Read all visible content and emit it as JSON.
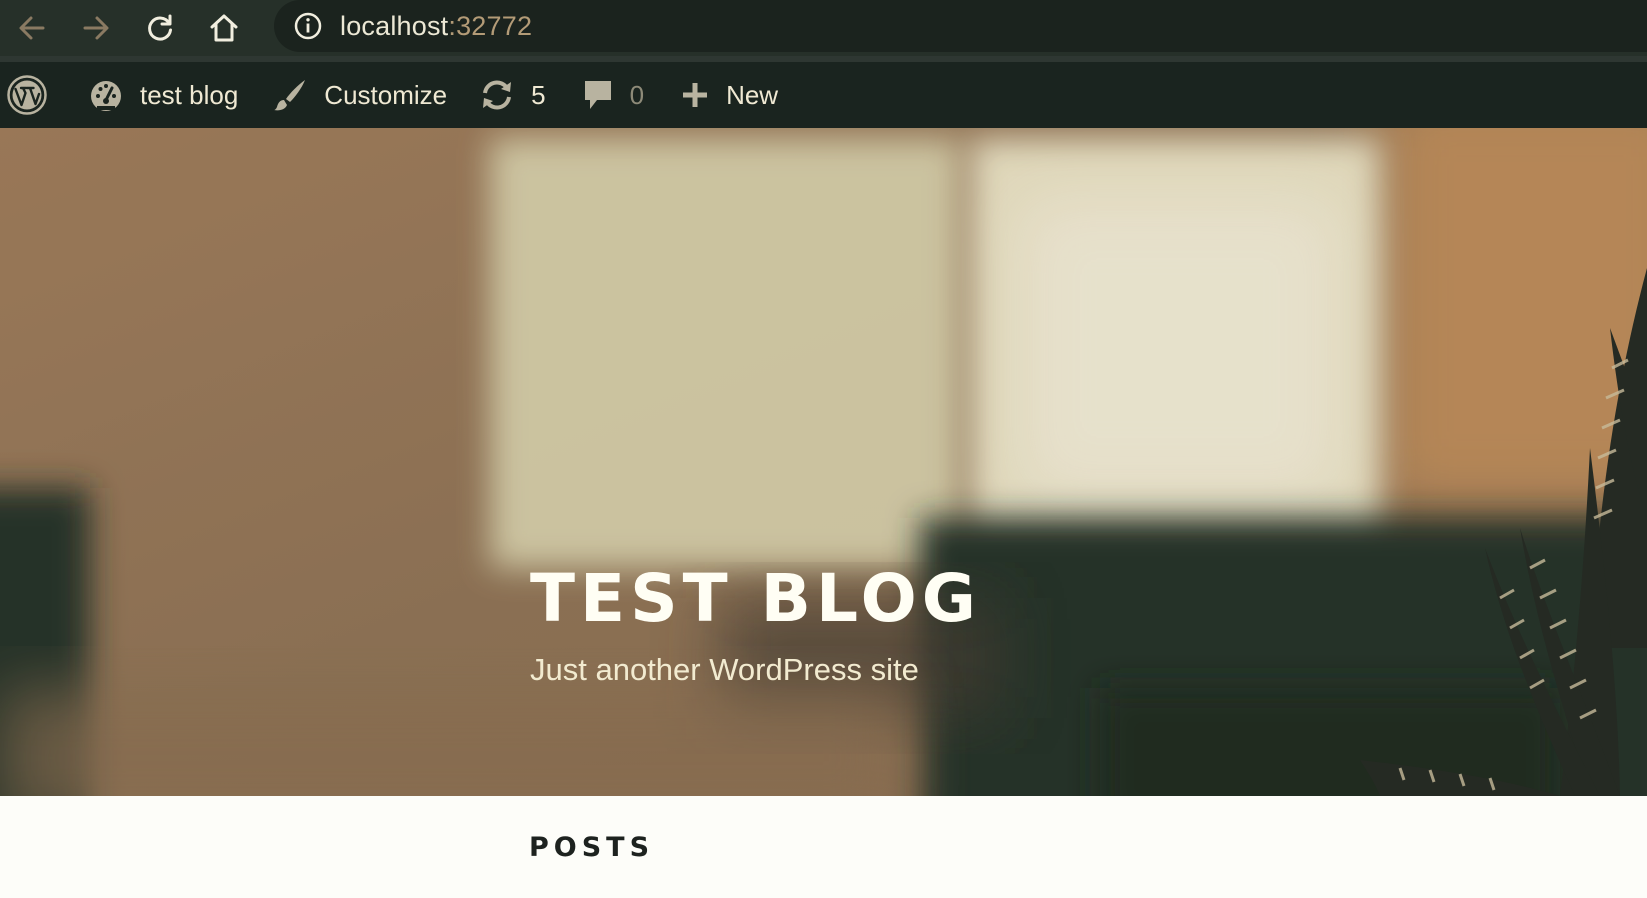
{
  "browser": {
    "back_icon": "arrow-left-icon",
    "forward_icon": "arrow-right-icon",
    "reload_icon": "reload-icon",
    "home_icon": "home-icon",
    "site_info_icon": "info-circle-icon",
    "url_host": "localhost",
    "url_port": ":32772"
  },
  "admin_bar": {
    "wp_logo_icon": "wordpress-logo-icon",
    "site_name": "test blog",
    "customize_label": "Customize",
    "updates_count": "5",
    "comments_count": "0",
    "new_label": "New"
  },
  "hero": {
    "site_title": "TEST BLOG",
    "tagline": "Just another WordPress site"
  },
  "content": {
    "section_heading": "POSTS"
  },
  "colors": {
    "chrome_bg": "#263029",
    "admin_bar_bg": "#1a241f",
    "admin_text": "#efe9d3",
    "port_color": "#b39b77",
    "hero_tone": "#97785a",
    "heading_text": "#1d221f"
  }
}
